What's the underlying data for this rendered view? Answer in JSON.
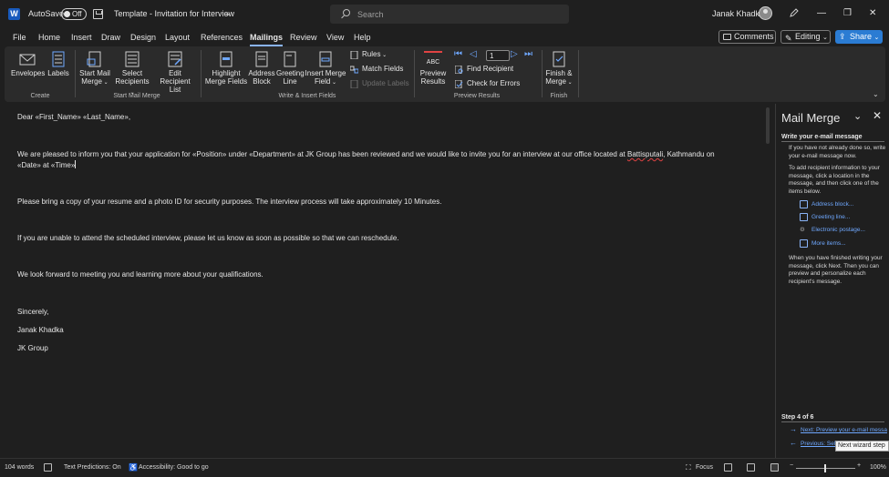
{
  "app": {
    "autosave_label": "AutoSave",
    "autosave_state": "Off",
    "doc_title": "Template - Invitation for Interview",
    "search_placeholder": "Search",
    "user_name": "Janak Khadka"
  },
  "menu_tabs": [
    "File",
    "Home",
    "Insert",
    "Draw",
    "Design",
    "Layout",
    "References",
    "Mailings",
    "Review",
    "View",
    "Help"
  ],
  "active_tab": "Mailings",
  "top_buttons": {
    "comments": "Comments",
    "editing": "Editing",
    "share": "Share"
  },
  "ribbon": {
    "create": {
      "label": "Create",
      "envelopes": "Envelopes",
      "labels": "Labels"
    },
    "start": {
      "label": "Start Mail Merge",
      "start_l1": "Start Mail",
      "start_l2": "Merge",
      "select_l1": "Select",
      "select_l2": "Recipients",
      "edit_l1": "Edit",
      "edit_l2": "Recipient List"
    },
    "write": {
      "label": "Write & Insert Fields",
      "highlight_l1": "Highlight",
      "highlight_l2": "Merge Fields",
      "address_l1": "Address",
      "address_l2": "Block",
      "greeting_l1": "Greeting",
      "greeting_l2": "Line",
      "insert_l1": "Insert Merge",
      "insert_l2": "Field",
      "rules": "Rules",
      "match_fields": "Match Fields",
      "update_labels": "Update Labels"
    },
    "preview": {
      "label": "Preview Results",
      "abc": "ABC",
      "preview_l1": "Preview",
      "preview_l2": "Results",
      "record_value": "1",
      "find_recipient": "Find Recipient",
      "check_errors": "Check for Errors"
    },
    "finish": {
      "label": "Finish",
      "finish_l1": "Finish &",
      "finish_l2": "Merge"
    }
  },
  "document": {
    "p1": "Dear «First_Name» «Last_Name»,",
    "p2_a": "We are pleased to inform you that your application for «Position» under «Department» at JK Group has been reviewed and we would like to invite you for an interview at our office located at ",
    "p2_b": "Battisputali",
    "p2_c": ", Kathmandu on",
    "p2_d": "«Date» at «Time»",
    "p3": "Please bring a copy of your resume and a photo ID for security purposes. The interview process will take approximately 10 Minutes.",
    "p4": "If you are unable to attend the scheduled interview, please let us know as soon as possible so that we can reschedule.",
    "p5": "We look forward to meeting you and learning more about your qualifications.",
    "p6": "Sincerely,",
    "p7": "Janak Khadka",
    "p8": "JK Group"
  },
  "pane": {
    "title": "Mail Merge",
    "heading": "Write your e-mail message",
    "para1": "If you have not already done so, write your e-mail message now.",
    "para2": "To add recipient information to your message, click a location in the message, and then click one of the items below.",
    "links": [
      "Address block...",
      "Greeting line...",
      "Electronic postage...",
      "More items..."
    ],
    "para3": "When you have finished writing your message, click Next. Then you can preview and personalize each recipient's message.",
    "step": "Step 4 of 6",
    "next": "Next: Preview your e-mail messa",
    "previous": "Previous: Sel",
    "tooltip": "Next wizard step"
  },
  "status": {
    "words": "104 words",
    "text_predictions": "Text Predictions: On",
    "accessibility": "Accessibility: Good to go",
    "focus": "Focus",
    "zoom": "100%"
  },
  "colors": {
    "accent": "#2b7cd3",
    "link": "#6fa8ff",
    "background": "#1f1f1f",
    "ribbon": "#2b2b2b"
  }
}
